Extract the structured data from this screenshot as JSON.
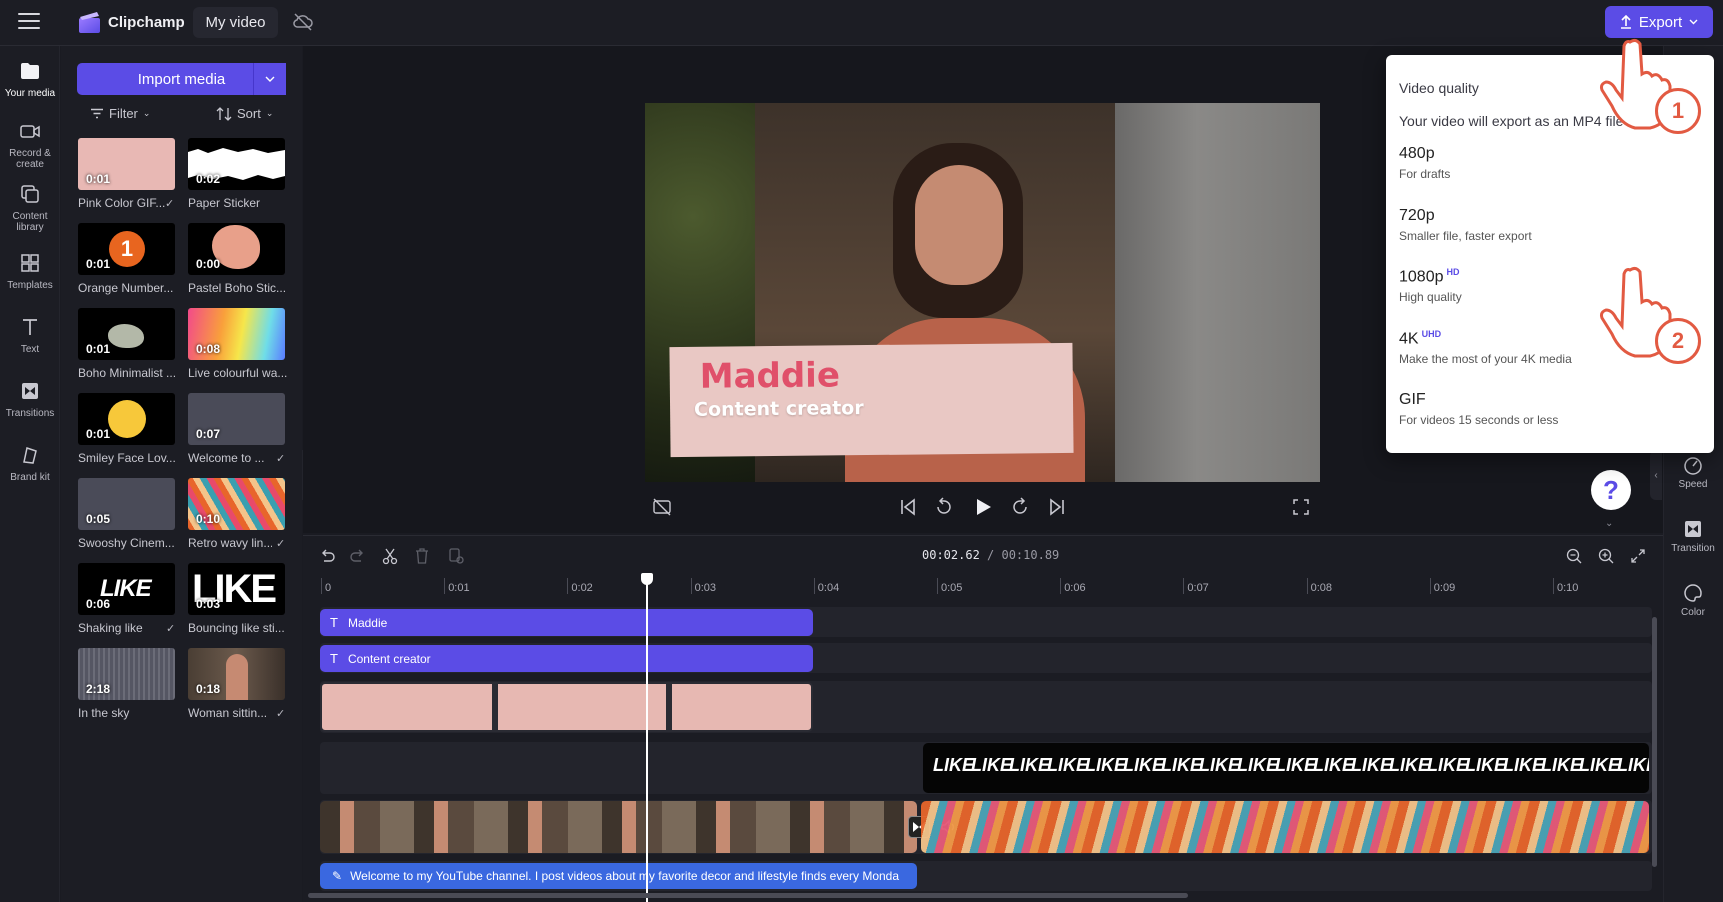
{
  "app": {
    "name": "Clipchamp",
    "project_title": "My video",
    "export_label": "Export"
  },
  "rail": [
    {
      "label": "Your media",
      "icon": "folder-icon"
    },
    {
      "label": "Record & create",
      "icon": "camera-icon"
    },
    {
      "label": "Content library",
      "icon": "library-icon"
    },
    {
      "label": "Templates",
      "icon": "templates-icon"
    },
    {
      "label": "Text",
      "icon": "text-icon"
    },
    {
      "label": "Transitions",
      "icon": "transitions-icon"
    },
    {
      "label": "Brand kit",
      "icon": "brand-kit-icon"
    }
  ],
  "media": {
    "import_label": "Import media",
    "filter_label": "Filter",
    "sort_label": "Sort",
    "items": [
      {
        "label": "Pink Color GIF...",
        "duration": "0:01",
        "checked": true
      },
      {
        "label": "Paper Sticker",
        "duration": "0:02",
        "checked": false
      },
      {
        "label": "Orange Number...",
        "duration": "0:01",
        "checked": false
      },
      {
        "label": "Pastel Boho Stic...",
        "duration": "0:00",
        "checked": false
      },
      {
        "label": "Boho Minimalist ...",
        "duration": "0:01",
        "checked": false
      },
      {
        "label": "Live colourful wa...",
        "duration": "0:08",
        "checked": false
      },
      {
        "label": "Smiley Face Lov...",
        "duration": "0:01",
        "checked": false
      },
      {
        "label": "Welcome to ...",
        "duration": "0:07",
        "checked": true
      },
      {
        "label": "Swooshy Cinem...",
        "duration": "0:05",
        "checked": false
      },
      {
        "label": "Retro wavy lin...",
        "duration": "0:10",
        "checked": true
      },
      {
        "label": "Shaking like",
        "duration": "0:06",
        "checked": true
      },
      {
        "label": "Bouncing like sti...",
        "duration": "0:03",
        "checked": false
      },
      {
        "label": "In the sky",
        "duration": "2:18",
        "checked": false
      },
      {
        "label": "Woman sittin...",
        "duration": "0:18",
        "checked": true
      }
    ],
    "tile_glyphs": {
      "orange_number": "1",
      "like_text": "LIKE"
    }
  },
  "preview": {
    "name_text": "Maddie",
    "role_text": "Content creator"
  },
  "timeline": {
    "current_time": "00:02.62",
    "total_time": "/ 00:10.89",
    "ruler": [
      "0",
      "0:01",
      "0:02",
      "0:03",
      "0:04",
      "0:05",
      "0:06",
      "0:07",
      "0:08",
      "0:09",
      "0:10"
    ],
    "playhead_seconds": 2.62,
    "clips": {
      "title": "Maddie",
      "subtitle": "Content creator",
      "caption": "Welcome to my YouTube channel. I post videos about my favorite decor and lifestyle finds every Monda"
    }
  },
  "right_rail": [
    {
      "label": "Speed",
      "icon": "speed-icon"
    },
    {
      "label": "Transition",
      "icon": "transition-icon"
    },
    {
      "label": "Color",
      "icon": "color-icon"
    }
  ],
  "export_menu": {
    "heading": "Video quality",
    "subheading": "Your video will export as an MP4 file",
    "options": [
      {
        "title": "480p",
        "badge": "",
        "desc": "For drafts"
      },
      {
        "title": "720p",
        "badge": "",
        "desc": "Smaller file, faster export"
      },
      {
        "title": "1080p",
        "badge": "HD",
        "desc": "High quality"
      },
      {
        "title": "4K",
        "badge": "UHD",
        "desc": "Make the most of your 4K media"
      },
      {
        "title": "GIF",
        "badge": "",
        "desc": "For videos 15 seconds or less"
      }
    ]
  },
  "help_label": "?",
  "step_markers": [
    "1",
    "2"
  ],
  "colors": {
    "accent": "#5b4ce6",
    "background": "#1a1b22",
    "panel": "#1c1d24"
  }
}
